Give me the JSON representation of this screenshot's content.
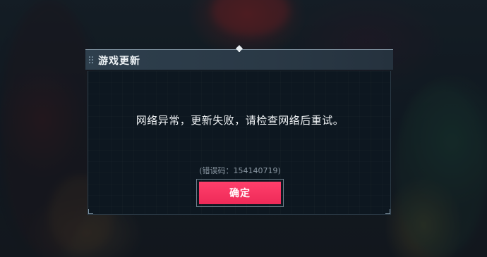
{
  "dialog": {
    "title": "游戏更新",
    "message": "网络异常，更新失败，请检查网络后重试。",
    "error_code": "(错误码：154140719)",
    "confirm_label": "确定"
  },
  "icons": {
    "grip": "drag-handle-icon",
    "pin": "pin-icon"
  },
  "colors": {
    "confirm_button": "#f02f5c",
    "title_bar": "#2c3b48",
    "dialog_body": "#0d1720"
  }
}
